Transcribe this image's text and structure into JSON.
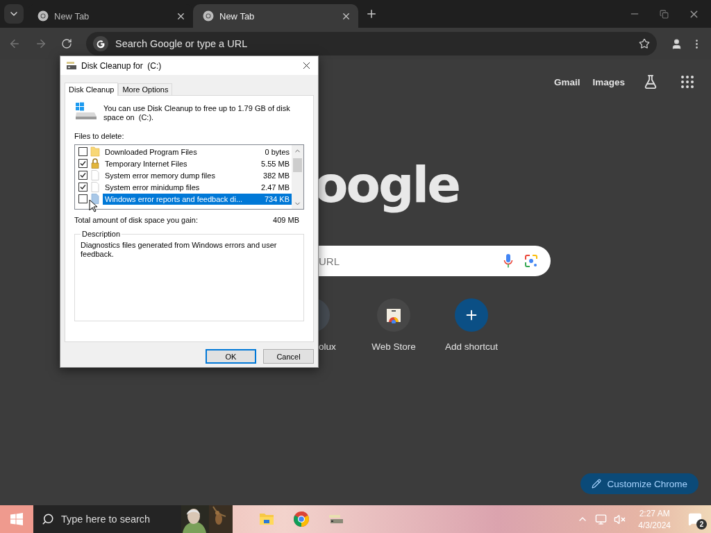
{
  "browser": {
    "tabs": [
      {
        "title": "New Tab",
        "selected": false
      },
      {
        "title": "New Tab",
        "selected": true
      }
    ],
    "address_bar": {
      "placeholder": "Search Google or type a URL"
    }
  },
  "new_tab_page": {
    "header_links": [
      "Gmail",
      "Images"
    ],
    "logo_text": "oogle",
    "search": {
      "placeholder": "URL"
    },
    "shortcuts": [
      {
        "label": "olux",
        "kind": "partial"
      },
      {
        "label": "Web Store",
        "kind": "store"
      },
      {
        "label": "Add shortcut",
        "kind": "add"
      }
    ],
    "customize_button": "Customize Chrome"
  },
  "dialog": {
    "title": "Disk Cleanup for  (C:)",
    "tabs": [
      {
        "label": "Disk Cleanup",
        "selected": true
      },
      {
        "label": "More Options",
        "selected": false
      }
    ],
    "intro": "You can use Disk Cleanup to free up to 1.79 GB of disk space on  (C:).",
    "files_label": "Files to delete:",
    "files": [
      {
        "name": "Downloaded Program Files",
        "size": "0 bytes",
        "checked": false,
        "selected": false,
        "kind": "folder"
      },
      {
        "name": "Temporary Internet Files",
        "size": "5.55 MB",
        "checked": true,
        "selected": false,
        "kind": "lock"
      },
      {
        "name": "System error memory dump files",
        "size": "382 MB",
        "checked": true,
        "selected": false,
        "kind": "file"
      },
      {
        "name": "System error minidump files",
        "size": "2.47 MB",
        "checked": true,
        "selected": false,
        "kind": "file"
      },
      {
        "name": "Windows error reports and feedback di...",
        "size": "734 KB",
        "checked": false,
        "selected": true,
        "kind": "report"
      }
    ],
    "total_label": "Total amount of disk space you gain:",
    "total_value": "409 MB",
    "description_label": "Description",
    "description": "Diagnostics files generated from Windows errors and user feedback.",
    "buttons": [
      {
        "label": "OK",
        "default": true
      },
      {
        "label": "Cancel",
        "default": false
      }
    ]
  },
  "taskbar": {
    "search_placeholder": "Type here to search",
    "time": "2:27 AM",
    "date": "4/3/2024",
    "notification_count": "2"
  }
}
